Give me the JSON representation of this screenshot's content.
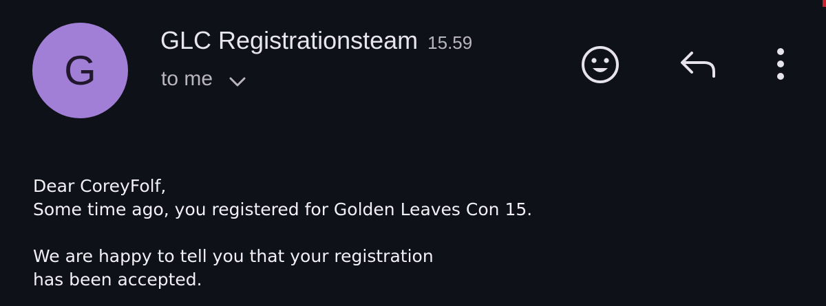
{
  "email": {
    "avatar_letter": "G",
    "sender_name": "GLC Registrationsteam",
    "time": "15.59",
    "recipient": "to me",
    "body": {
      "greeting": "Dear CoreyFolf,",
      "line1": "Some time ago, you registered for Golden Leaves Con 15.",
      "line2": "We are happy to tell you that your registration",
      "line3": "has been accepted."
    }
  },
  "actions": {
    "emoji_icon": "emoji-smile-icon",
    "reply_icon": "reply-arrow-icon",
    "more_icon": "more-vert-icon",
    "expand_icon": "chevron-down-icon"
  },
  "colors": {
    "background": "#0f1118",
    "avatar": "#a17fd6",
    "text_primary": "#e8e6ed",
    "text_secondary": "#b9b6c0"
  }
}
